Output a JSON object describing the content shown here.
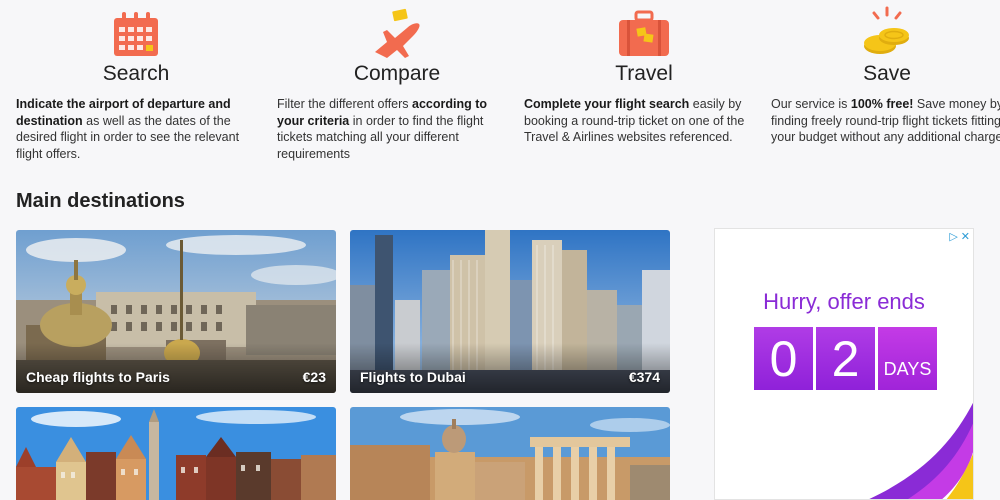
{
  "features": [
    {
      "title": "Search",
      "icon": "calendar-icon",
      "text_parts": [
        {
          "bold": true,
          "text": "Indicate the airport of departure and destination"
        },
        {
          "bold": false,
          "text": " as well as the dates of the desired flight in order to see the relevant flight offers."
        }
      ]
    },
    {
      "title": "Compare",
      "icon": "airplane-icon",
      "text_parts": [
        {
          "bold": false,
          "text": "Filter the different offers "
        },
        {
          "bold": true,
          "text": "according to your criteria"
        },
        {
          "bold": false,
          "text": " in order to find the flight tickets matching all your different requirements"
        }
      ]
    },
    {
      "title": "Travel",
      "icon": "suitcase-icon",
      "text_parts": [
        {
          "bold": true,
          "text": "Complete your flight search"
        },
        {
          "bold": false,
          "text": " easily by booking a round-trip ticket on one of the Travel & Airlines websites referenced."
        }
      ]
    },
    {
      "title": "Save",
      "icon": "coins-icon",
      "text_parts": [
        {
          "bold": false,
          "text": "Our service is "
        },
        {
          "bold": true,
          "text": "100% free!"
        },
        {
          "bold": false,
          "text": " Save money by finding freely round-trip flight tickets fitting your budget without any additional charge."
        }
      ]
    }
  ],
  "main": {
    "section_title": "Main destinations",
    "destinations": [
      {
        "label": "Cheap flights to Paris",
        "price": "€23"
      },
      {
        "label": "Flights to Dubai",
        "price": "€374"
      },
      {
        "label": "",
        "price": ""
      },
      {
        "label": "",
        "price": ""
      }
    ]
  },
  "ad": {
    "headline": "Hurry, offer ends",
    "digits": [
      "0",
      "2"
    ],
    "unit": "DAYS",
    "choices": [
      "▷",
      "✕"
    ]
  },
  "colors": {
    "icon_accent": "#f26b4f",
    "coin_accent": "#f5c518",
    "ad_purple": "#8a2bd6"
  }
}
